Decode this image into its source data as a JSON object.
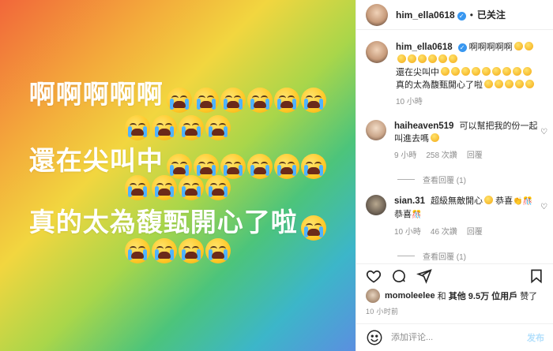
{
  "image_post": {
    "line1_text": "啊啊啊啊啊",
    "line2_text": "還在尖叫中",
    "line3_text": "真的太為馥甄開心了啦",
    "emoji_name": "loudly-crying-face"
  },
  "header": {
    "username": "him_ella0618",
    "separator": "•",
    "follow_status": "已关注"
  },
  "caption": {
    "username": "him_ella0618",
    "text_line1": "啊啊啊啊啊",
    "text_line2": "還在尖叫中",
    "text_line3": "真的太為馥甄開心了啦",
    "time": "10 小時"
  },
  "comments": [
    {
      "username": "haiheaven519",
      "text": "可以幫把我的份一起叫進去嗎",
      "time": "9 小時",
      "likes": "258 次讚",
      "reply_label": "回覆",
      "view_replies": "查看回覆 (1)"
    },
    {
      "username": "sian.31",
      "text": "超級無敵開心",
      "text_tail": "恭喜",
      "text_line2": "恭喜",
      "time": "10 小時",
      "likes": "46 次讚",
      "reply_label": "回覆",
      "view_replies": "查看回覆 (1)"
    }
  ],
  "likes": {
    "username": "momoleelee",
    "connector": "和",
    "others": "其他 9.5万 位用戶",
    "suffix": "赞了"
  },
  "time_ago": "10 小时前",
  "add_comment": {
    "placeholder": "添加评论...",
    "post_label": "发布"
  },
  "colors": {
    "verified_blue": "#3897f0",
    "post_button_disabled": "#b2dffc",
    "meta_gray": "#8e8e8e"
  }
}
